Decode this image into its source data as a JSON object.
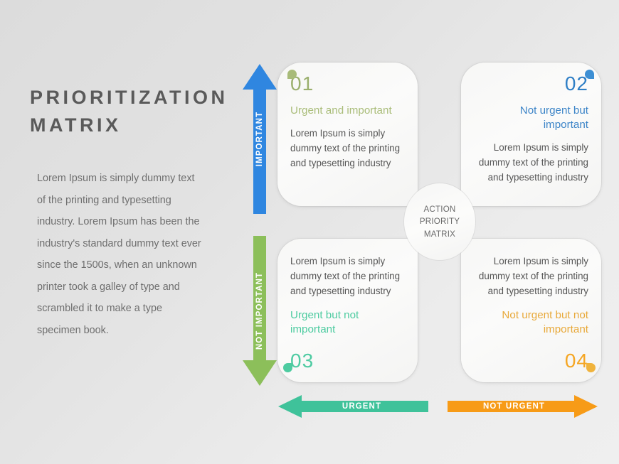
{
  "title": "PRIORITIZATION MATRIX",
  "intro": "Lorem Ipsum is simply dummy text of the printing and typesetting industry. Lorem Ipsum has been the industry's standard dummy text ever since the 1500s, when an unknown printer took a galley of type and scrambled it to make a type specimen book.",
  "center": {
    "label": "ACTION PRIORITY MATRIX"
  },
  "axes": {
    "vertical_top": {
      "label": "IMPORTANT",
      "color": "#2f86e0",
      "direction": "up"
    },
    "vertical_bottom": {
      "label": "NOT IMPORTANT",
      "color": "#8cbf5a",
      "direction": "down"
    },
    "horizontal_left": {
      "label": "URGENT",
      "color": "#3fc29a",
      "direction": "left"
    },
    "horizontal_right": {
      "label": "NOT URGENT",
      "color": "#f79b17",
      "direction": "right"
    }
  },
  "quadrants": [
    {
      "number": "01",
      "heading": "Urgent and important",
      "body": "Lorem Ipsum is simply dummy text of the printing and typesetting industry",
      "accent": "#aabd7a",
      "number_color": "#9aaf6d",
      "leaf_color": "#a8bb79",
      "align": "left",
      "number_position": "top"
    },
    {
      "number": "02",
      "heading": "Not urgent but important",
      "body": "Lorem Ipsum is simply dummy text of the printing and typesetting industry",
      "accent": "#3d85c8",
      "number_color": "#2f7fc6",
      "leaf_color": "#3d8fd4",
      "align": "right",
      "number_position": "top"
    },
    {
      "number": "03",
      "heading": "Urgent but not important",
      "body": "Lorem Ipsum is simply dummy text of the printing and typesetting industry",
      "accent": "#4dcba0",
      "number_color": "#4ecba2",
      "leaf_color": "#4dcba0",
      "align": "left",
      "number_position": "bottom"
    },
    {
      "number": "04",
      "heading": "Not urgent but not important",
      "body": "Lorem Ipsum is simply dummy text of the printing and typesetting industry",
      "accent": "#e8a93a",
      "number_color": "#f5a623",
      "leaf_color": "#f0b33c",
      "align": "right",
      "number_position": "bottom"
    }
  ]
}
